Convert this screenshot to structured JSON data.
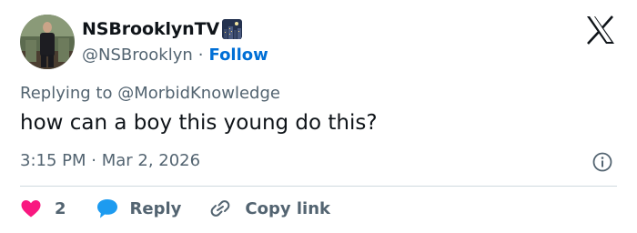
{
  "author": {
    "display_name": "NSBrooklynTV",
    "name_emoji": "night-city-emoji",
    "handle": "@NSBrooklyn",
    "separator": "·",
    "follow_label": "Follow"
  },
  "tweet": {
    "reply_prefix": "Replying to ",
    "reply_to": "@MorbidKnowledge",
    "text": "how can a boy this young do this?",
    "timestamp": "3:15 PM · Mar 2, 2026"
  },
  "actions": {
    "like_count": "2",
    "reply_label": "Reply",
    "copy_link_label": "Copy link"
  },
  "icons": {
    "brand": "x-logo-icon",
    "info": "info-icon",
    "like": "heart-icon",
    "reply": "reply-bubble-icon",
    "copy": "link-icon"
  },
  "colors": {
    "text_primary": "#0f1419",
    "text_secondary": "#536471",
    "link": "#006fd6",
    "like": "#f91880",
    "reply": "#1d9bf0",
    "divider": "#cfd9de"
  }
}
